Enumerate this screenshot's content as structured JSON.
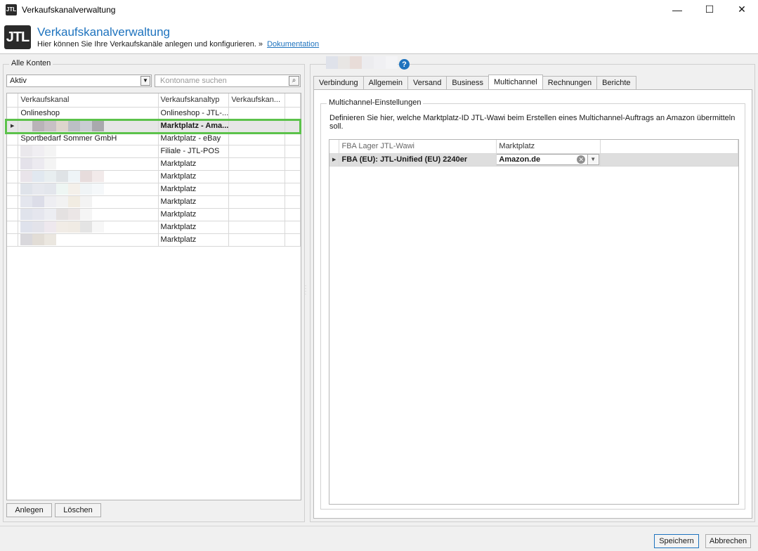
{
  "window": {
    "title": "Verkaufskanalverwaltung",
    "app_icon": "JTL",
    "minimize": "—",
    "maximize": "☐",
    "close": "✕"
  },
  "header": {
    "logo": "JTL",
    "title": "Verkaufskanalverwaltung",
    "subtitle": "Hier können Sie Ihre Verkaufskanäle anlegen und konfigurieren. »",
    "doc_link": "Dokumentation"
  },
  "left": {
    "group_title": "Alle Konten",
    "filter_value": "Aktiv",
    "search_placeholder": "Kontoname suchen",
    "columns": [
      "Verkaufskanal",
      "Verkaufskanaltyp",
      "Verkaufskan..."
    ],
    "rows": [
      {
        "name": "Onlineshop",
        "type": "Onlineshop - JTL-...",
        "extra": ""
      },
      {
        "name": "",
        "type": "Marktplatz - Ama...",
        "extra": ""
      },
      {
        "name": "Sportbedarf Sommer GmbH",
        "type": "Marktplatz - eBay",
        "extra": ""
      },
      {
        "name": "",
        "type": "Filiale - JTL-POS",
        "extra": ""
      },
      {
        "name": "",
        "type": "Marktplatz",
        "extra": ""
      },
      {
        "name": "",
        "type": "Marktplatz",
        "extra": ""
      },
      {
        "name": "",
        "type": "Marktplatz",
        "extra": ""
      },
      {
        "name": "",
        "type": "Marktplatz",
        "extra": ""
      },
      {
        "name": "",
        "type": "Marktplatz",
        "extra": ""
      },
      {
        "name": "",
        "type": "Marktplatz",
        "extra": ""
      },
      {
        "name": "",
        "type": "Marktplatz",
        "extra": ""
      }
    ],
    "buttons": {
      "add": "Anlegen",
      "delete": "Löschen"
    }
  },
  "right": {
    "help": "?",
    "tabs": [
      "Verbindung",
      "Allgemein",
      "Versand",
      "Business",
      "Multichannel",
      "Rechnungen",
      "Berichte"
    ],
    "active_tab": "Multichannel",
    "group_title": "Multichannel-Einstellungen",
    "description": "Definieren Sie hier, welche Marktplatz-ID JTL-Wawi beim Erstellen eines Multichannel-Auftrags an Amazon übermitteln soll.",
    "columns": [
      "FBA Lager JTL-Wawi",
      "Marktplatz"
    ],
    "rows": [
      {
        "warehouse": "FBA (EU): JTL-Unified (EU) 2240er",
        "marketplace": "Amazon.de"
      }
    ]
  },
  "footer": {
    "save": "Speichern",
    "cancel": "Abbrechen"
  },
  "colors": {
    "accent": "#1e73be",
    "highlight": "#5cc24b"
  }
}
